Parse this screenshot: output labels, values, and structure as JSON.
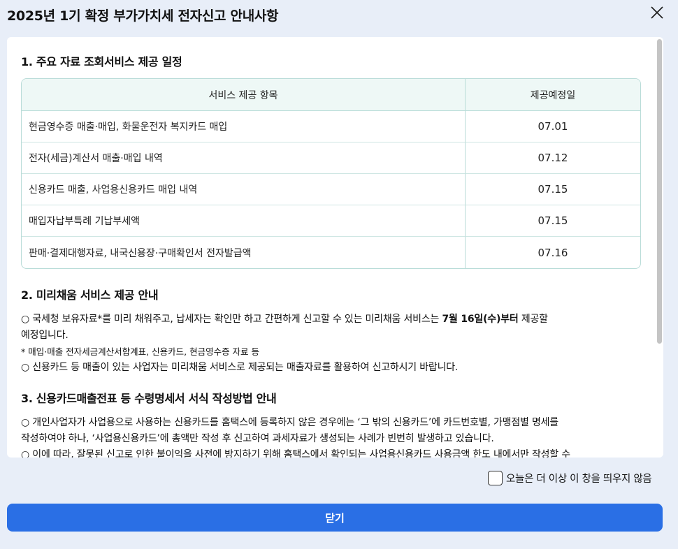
{
  "modal": {
    "title": "2025년 1기 확정 부가가치세 전자신고 안내사항"
  },
  "section1": {
    "heading": "1. 주요 자료 조회서비스 제공 일정",
    "table": {
      "headers": [
        "서비스 제공 항목",
        "제공예정일"
      ],
      "rows": [
        {
          "item": "현금영수증 매출·매입, 화물운전자 복지카드 매입",
          "date": "07.01"
        },
        {
          "item": "전자(세금)계산서 매출·매입 내역",
          "date": "07.12"
        },
        {
          "item": "신용카드 매출, 사업용신용카드 매입 내역",
          "date": "07.15"
        },
        {
          "item": "매입자납부특례 기납부세액",
          "date": "07.15"
        },
        {
          "item": "판매·결제대행자료, 내국신용장·구매확인서 전자발급액",
          "date": "07.16"
        }
      ]
    }
  },
  "section2": {
    "heading": "2. 미리채움 서비스 제공 안내",
    "p1_before": "○ 국세청 보유자료*를 미리 채워주고, 납세자는 확인만 하고 간편하게 신고할 수 있는 미리채움 서비스는 ",
    "p1_bold": "7월 16일(수)부터",
    "p1_after": " 제공할",
    "p1_line2": "예정입니다.",
    "note": "* 매입·매출 전자세금계산서합계표, 신용카드, 현금영수증 자료 등",
    "p2": "○ 신용카드 등 매출이 있는 사업자는 미리채움 서비스로 제공되는 매출자료를 활용하여 신고하시기 바랍니다."
  },
  "section3": {
    "heading": "3. 신용카드매출전표 등 수령명세서 서식 작성방법 안내",
    "p1_line1": "○ 개인사업자가 사업용으로 사용하는 신용카드를 홈택스에 등록하지 않은 경우에는 ‘그 밖의 신용카드’에 카드번호별, 가맹점별 명세를",
    "p1_line2": "작성하여야 하나, ‘사업용신용카드’에 총액만 작성 후 신고하여 과세자료가 생성되는 사례가 빈번히 발생하고 있습니다.",
    "p2_line1": "○ 이에 따라, 잘못된 신고로 인한 불이익을 사전에 방지하기 위해 홈택스에서 확인되는  사업용신용카드 사용금액 한도 내에서만 작성할 수"
  },
  "footer": {
    "dont_show_label": "오늘은 더 이상 이 창을 띄우지 않음",
    "close_label": "닫기"
  }
}
